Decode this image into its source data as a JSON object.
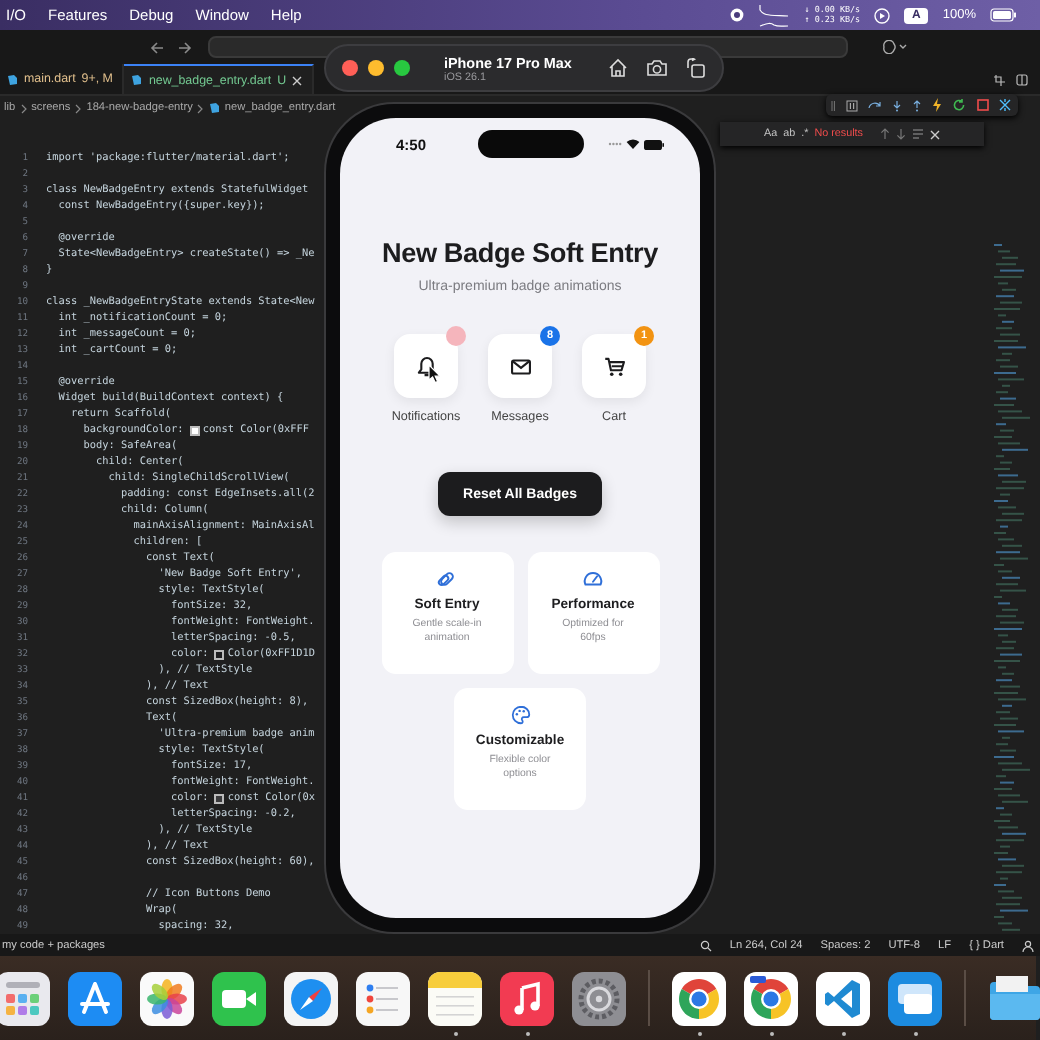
{
  "menu_bar": {
    "items": [
      "I/O",
      "Features",
      "Debug",
      "Window",
      "Help"
    ],
    "net_down": "↓ 0.00 KB/s",
    "net_up": "↑ 0.23 KB/s",
    "input_source": "A",
    "battery": "100%"
  },
  "editor": {
    "tabs": [
      {
        "label": "main.dart",
        "status": "9+, M",
        "color": "#e2c08d",
        "selected": false
      },
      {
        "label": "new_badge_entry.dart",
        "status": "U",
        "color": "#73c991",
        "selected": true
      }
    ],
    "breadcrumb": [
      "lib",
      "screens",
      "184-new-badge-entry",
      "new_badge_entry.dart"
    ],
    "lines": [
      {
        "n": "1",
        "text": "import 'package:flutter/material.dart';"
      },
      {
        "n": "2"
      },
      {
        "n": "3",
        "text": "class NewBadgeEntry extends StatefulWidget"
      },
      {
        "n": "4",
        "text": "  const NewBadgeEntry({super.key});"
      },
      {
        "n": "5"
      },
      {
        "n": "6",
        "text": "  @override"
      },
      {
        "n": "7",
        "text": "  State<NewBadgeEntry> createState() => _Ne"
      },
      {
        "n": "8",
        "text": "}"
      },
      {
        "n": "9"
      },
      {
        "n": "10",
        "text": "class _NewBadgeEntryState extends State<New"
      },
      {
        "n": "11",
        "text": "  int _notificationCount = 0;"
      },
      {
        "n": "12",
        "text": "  int _messageCount = 0;"
      },
      {
        "n": "13",
        "text": "  int _cartCount = 0;"
      },
      {
        "n": "14"
      },
      {
        "n": "15",
        "text": "  @override"
      },
      {
        "n": "16",
        "text": "  Widget build(BuildContext context) {"
      },
      {
        "n": "17",
        "text": "    return Scaffold("
      },
      {
        "n": "18",
        "text": "      backgroundColor: ",
        "color": "#ffffff",
        "rest": "const Color(0xFFF"
      },
      {
        "n": "19",
        "text": "      body: SafeArea("
      },
      {
        "n": "20",
        "text": "        child: Center("
      },
      {
        "n": "21",
        "text": "          child: SingleChildScrollView("
      },
      {
        "n": "22",
        "text": "            padding: const EdgeInsets.all(2"
      },
      {
        "n": "23",
        "text": "            child: Column("
      },
      {
        "n": "24",
        "text": "              mainAxisAlignment: MainAxisAl"
      },
      {
        "n": "25",
        "text": "              children: ["
      },
      {
        "n": "26",
        "text": "                const Text("
      },
      {
        "n": "27",
        "text": "                  'New Badge Soft Entry',"
      },
      {
        "n": "28",
        "text": "                  style: TextStyle("
      },
      {
        "n": "29",
        "text": "                    fontSize: 32,"
      },
      {
        "n": "30",
        "text": "                    fontWeight: FontWeight."
      },
      {
        "n": "31",
        "text": "                    letterSpacing: -0.5,"
      },
      {
        "n": "32",
        "text": "                    color: ",
        "color": "#1d1d1f",
        "rest": "Color(0xFF1D1D"
      },
      {
        "n": "33",
        "text": "                  ), // TextStyle"
      },
      {
        "n": "34",
        "text": "                ), // Text"
      },
      {
        "n": "35",
        "text": "                const SizedBox(height: 8),"
      },
      {
        "n": "36",
        "text": "                Text("
      },
      {
        "n": "37",
        "text": "                  'Ultra-premium badge anim"
      },
      {
        "n": "38",
        "text": "                  style: TextStyle("
      },
      {
        "n": "39",
        "text": "                    fontSize: 17,"
      },
      {
        "n": "40",
        "text": "                    fontWeight: FontWeight."
      },
      {
        "n": "41",
        "text": "                    color: ",
        "color": "#3a3a3c",
        "rest": "const Color(0x"
      },
      {
        "n": "42",
        "text": "                    letterSpacing: -0.2,"
      },
      {
        "n": "43",
        "text": "                  ), // TextStyle"
      },
      {
        "n": "44",
        "text": "                ), // Text"
      },
      {
        "n": "45",
        "text": "                const SizedBox(height: 60),"
      },
      {
        "n": "46"
      },
      {
        "n": "47",
        "text": "                // Icon Buttons Demo"
      },
      {
        "n": "48",
        "text": "                Wrap("
      },
      {
        "n": "49",
        "text": "                  spacing: 32,"
      }
    ],
    "find": {
      "toggles": [
        "Aa",
        "ab",
        ".*"
      ],
      "result": "No results"
    },
    "status_bar": {
      "left": "my code + packages",
      "items": [
        "Ln 264, Col 24",
        "Spaces: 2",
        "UTF-8",
        "LF",
        "{ } Dart"
      ]
    }
  },
  "simulator": {
    "title": "iPhone 17 Pro Max",
    "subtitle": "iOS 26.1"
  },
  "phone": {
    "time": "4:50",
    "title": "New Badge Soft Entry",
    "subtitle": "Ultra-premium badge animations",
    "icon_buttons": [
      {
        "kind": "bell",
        "label": "Notifications",
        "color": "#f5b5bc",
        "pointer_over": true
      },
      {
        "kind": "envelope",
        "label": "Messages",
        "badge": "8",
        "color": "#1a73e8",
        "pointer_over": false
      },
      {
        "kind": "cart",
        "label": "Cart",
        "badge": "1",
        "color": "#f29312",
        "pointer_over": false
      }
    ],
    "reset_button": "Reset All Badges",
    "features": [
      {
        "kind": "pills",
        "title": "Soft Entry",
        "description": "Gentle scale-in animation"
      },
      {
        "kind": "gauge",
        "title": "Performance",
        "description": "Optimized for 60fps"
      },
      {
        "kind": "palette",
        "title": "Customizable",
        "description": "Flexible color options"
      }
    ]
  },
  "dock": {
    "apps": [
      {
        "kind": "launchpad",
        "running": false
      },
      {
        "kind": "appstore",
        "running": false
      },
      {
        "kind": "photos",
        "running": false
      },
      {
        "kind": "facetime",
        "running": false
      },
      {
        "kind": "safari",
        "running": false
      },
      {
        "kind": "reminders",
        "running": false
      },
      {
        "kind": "notes",
        "running": true
      },
      {
        "kind": "music",
        "running": true
      },
      {
        "kind": "settings",
        "running": false
      },
      {
        "kind": "separator"
      },
      {
        "kind": "chrome",
        "running": true
      },
      {
        "kind": "chrome_beta",
        "running": true
      },
      {
        "kind": "vscode",
        "running": true
      },
      {
        "kind": "windows_app",
        "running": true
      },
      {
        "kind": "separator"
      },
      {
        "kind": "folder",
        "running": false
      }
    ]
  }
}
